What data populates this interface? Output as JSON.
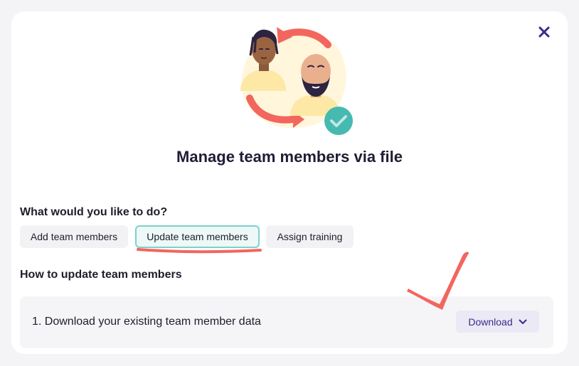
{
  "dialog": {
    "title": "Manage team members via file",
    "question": "What would you like to do?",
    "options": [
      {
        "label": "Add team members",
        "selected": false
      },
      {
        "label": "Update team members",
        "selected": true
      },
      {
        "label": "Assign training",
        "selected": false
      }
    ],
    "section_title": "How to update team members",
    "steps": [
      {
        "text": "1. Download your existing team member data",
        "button_label": "Download"
      }
    ]
  },
  "icons": {
    "close": "close-x-icon",
    "dropdown": "chevron-down-icon",
    "success": "check-circle-icon"
  },
  "colors": {
    "accent": "#3b2a8c",
    "selected_border": "#7fd1ca",
    "annotation": "#f2665e",
    "check": "#46b9b0"
  }
}
